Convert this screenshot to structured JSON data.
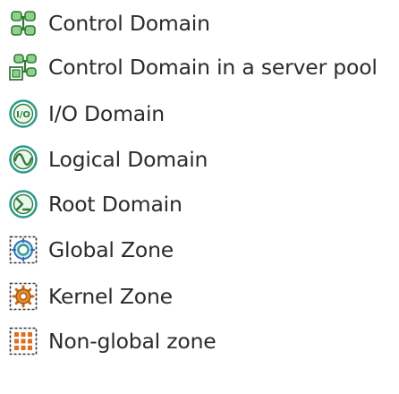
{
  "legend": {
    "items": [
      {
        "label": "Control Domain",
        "icon": "control-domain-icon"
      },
      {
        "label": "Control Domain in a server pool",
        "icon": "control-domain-server-pool-icon"
      },
      {
        "label": "I/O Domain",
        "icon": "io-domain-icon"
      },
      {
        "label": "Logical Domain",
        "icon": "logical-domain-icon"
      },
      {
        "label": "Root Domain",
        "icon": "root-domain-icon"
      },
      {
        "label": "Global Zone",
        "icon": "global-zone-icon"
      },
      {
        "label": "Kernel Zone",
        "icon": "kernel-zone-icon"
      },
      {
        "label": "Non-global zone",
        "icon": "non-global-zone-icon"
      }
    ],
    "io_icon_text": "I/O",
    "colors": {
      "green_dark": "#2f7a34",
      "green_light": "#8fd08a",
      "teal": "#2e9c8f",
      "blue": "#2f6fb5",
      "orange": "#c96a16",
      "text": "#2b2b2b"
    }
  }
}
